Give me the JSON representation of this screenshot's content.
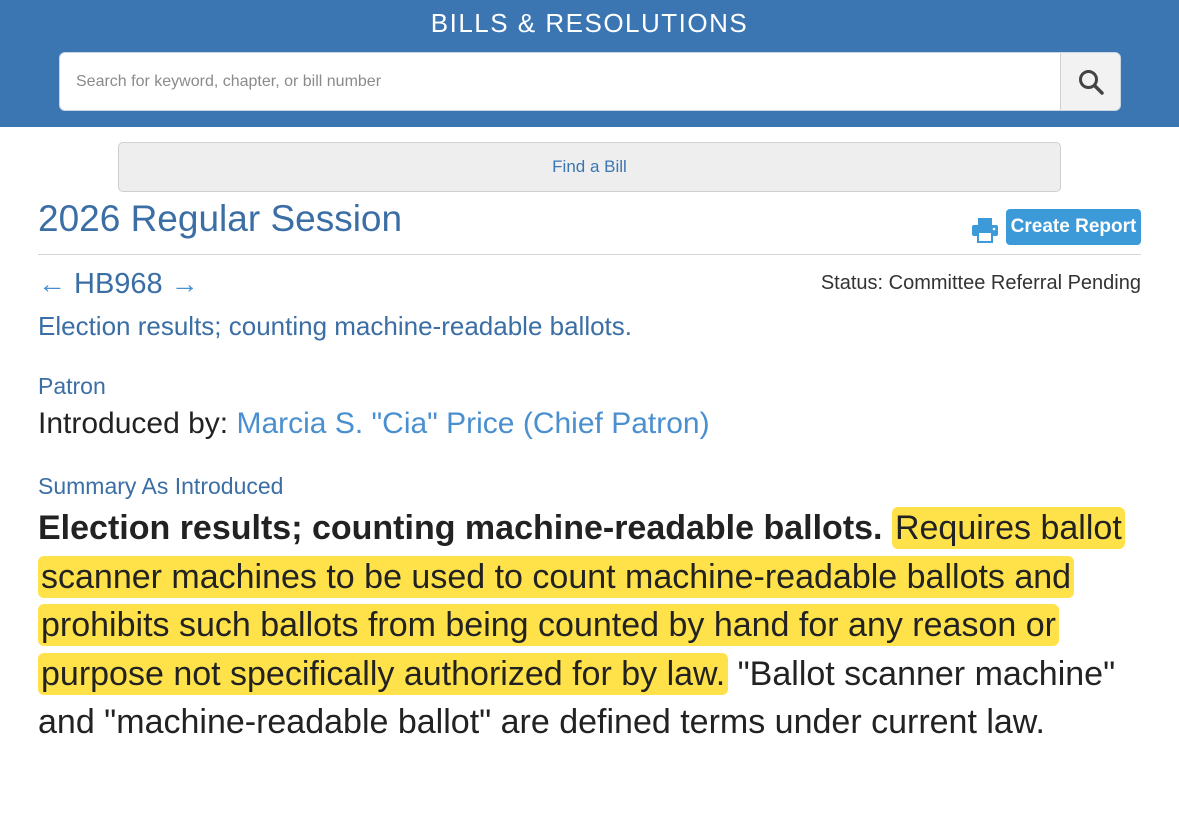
{
  "header": {
    "title": "BILLS & RESOLUTIONS",
    "search_placeholder": "Search for keyword, chapter, or bill number",
    "search_icon": "search-icon"
  },
  "find_bill_label": "Find a Bill",
  "session": {
    "title": "2026 Regular Session",
    "create_report_label": "Create Report",
    "print_icon": "printer-icon"
  },
  "bill": {
    "prev_icon": "arrow-left-icon",
    "number": "HB968",
    "next_icon": "arrow-right-icon",
    "status": "Status: Committee Referral Pending",
    "title": "Election results; counting machine-readable ballots."
  },
  "patron": {
    "label": "Patron",
    "introduced_prefix": "Introduced by:",
    "name": "Marcia S. \"Cia\" Price (Chief Patron)"
  },
  "summary": {
    "label": "Summary As Introduced",
    "bold_lead": "Election results; counting machine-readable ballots.",
    "highlighted": "Requires ballot scanner machines to be used to count machine-readable ballots and prohibits such ballots from being counted by hand for any reason or purpose not specifically authorized for by law.",
    "rest": "\"Ballot scanner machine\" and \"machine-readable ballot\" are defined terms under current law."
  },
  "colors": {
    "header_bg": "#3b76b3",
    "link": "#3b6ea5",
    "button": "#3d9ad9",
    "highlight": "#ffe24a"
  }
}
